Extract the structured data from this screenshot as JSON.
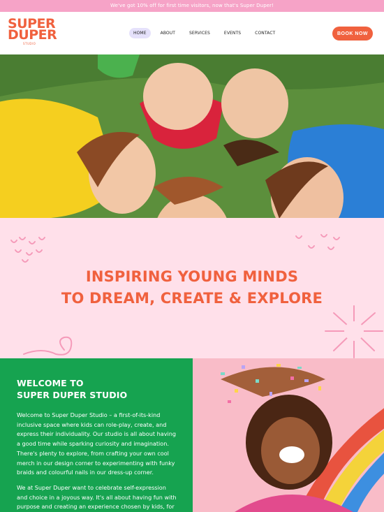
{
  "promo": {
    "text": "We've got 10% off for first time visitors, now that's Super Duper!"
  },
  "logo": {
    "line1": "SUPER",
    "line2": "DUPER",
    "line3": "STUDIO"
  },
  "nav": {
    "items": [
      {
        "label": "HOME",
        "active": true
      },
      {
        "label": "ABOUT",
        "active": false
      },
      {
        "label": "SERVICES",
        "active": false
      },
      {
        "label": "EVENTS",
        "active": false
      },
      {
        "label": "CONTACT",
        "active": false
      }
    ],
    "book_label": "BOOK NOW"
  },
  "hero": {
    "image": "children-lying-in-circle-on-grass-photo"
  },
  "mission": {
    "line1": "INSPIRING YOUNG MINDS",
    "line2": "TO DREAM, CREATE & EXPLORE"
  },
  "welcome": {
    "title_line1": "WELCOME TO",
    "title_line2": "SUPER DUPER STUDIO",
    "para1": "Welcome to Super Duper Studio – a first-of-its-kind inclusive space where kids can role-play, create, and express their individuality. Our studio is all about having a good time while sparking curiosity and imagination. There's plenty to explore, from crafting your own cool merch in our design corner to experimenting with funky braids and colourful nails in our dress-up corner.",
    "para2": "We at Super Duper want to celebrate self-expression and choice in a joyous way. It's all about having fun with purpose and creating an experience chosen by kids, for"
  },
  "photo2": {
    "image": "laughing-girl-with-confetti-photo"
  },
  "colors": {
    "accent": "#f0613e",
    "promo_bg": "#f6a3c7",
    "mission_bg": "#ffe0ea",
    "welcome_bg": "#16a350",
    "nav_active": "#e5e1fb"
  }
}
